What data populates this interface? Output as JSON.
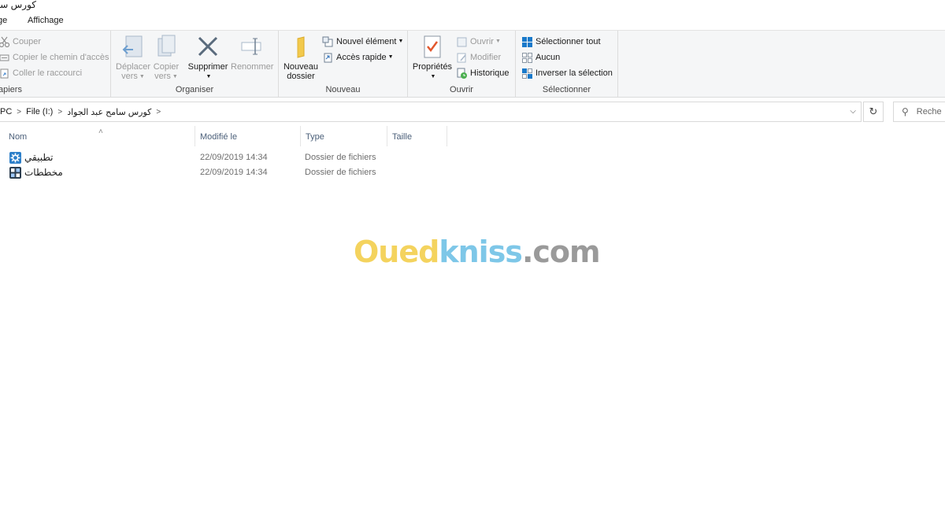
{
  "window": {
    "title": "كورس سامح عبد الجواد"
  },
  "tabs": [
    {
      "label": "ge"
    },
    {
      "label": "Affichage"
    }
  ],
  "ribbon": {
    "presse_papiers": {
      "label": "apiers",
      "couper": "Couper",
      "copier_chemin": "Copier le chemin d'accès",
      "coller_raccourci": "Coller le raccourci"
    },
    "organiser": {
      "label": "Organiser",
      "deplacer": [
        "Déplacer",
        "vers"
      ],
      "copier": [
        "Copier",
        "vers"
      ],
      "supprimer": "Supprimer",
      "renommer": "Renommer"
    },
    "nouveau": {
      "label": "Nouveau",
      "nouveau_dossier": [
        "Nouveau",
        "dossier"
      ],
      "nouvel_element": "Nouvel élément",
      "acces_rapide": "Accès rapide"
    },
    "ouvrir": {
      "label": "Ouvrir",
      "proprietes": "Propriétés",
      "ouvrir": "Ouvrir",
      "modifier": "Modifier",
      "historique": "Historique"
    },
    "selectionner": {
      "label": "Sélectionner",
      "tout": "Sélectionner tout",
      "aucun": "Aucun",
      "inverser": "Inverser la sélection"
    }
  },
  "address": {
    "crumbs": [
      "PC",
      "File (I:)",
      "كورس سامح عبد الجواد"
    ],
    "search_placeholder": "Reche"
  },
  "columns": {
    "name": "Nom",
    "modified": "Modifié le",
    "type": "Type",
    "size": "Taille"
  },
  "files": [
    {
      "name": "تطبيقي",
      "modified": "22/09/2019 14:34",
      "type": "Dossier de fichiers",
      "icon": "gear-folder-icon"
    },
    {
      "name": "مخططات",
      "modified": "22/09/2019 14:34",
      "type": "Dossier de fichiers",
      "icon": "grid-folder-icon"
    }
  ],
  "watermark": {
    "part1": "Oued",
    "part2": "kniss",
    "part3": ".com"
  },
  "colors": {
    "header_text": "#4c607a",
    "ribbon_bg": "#f5f6f7",
    "accent": "#1979ca"
  }
}
